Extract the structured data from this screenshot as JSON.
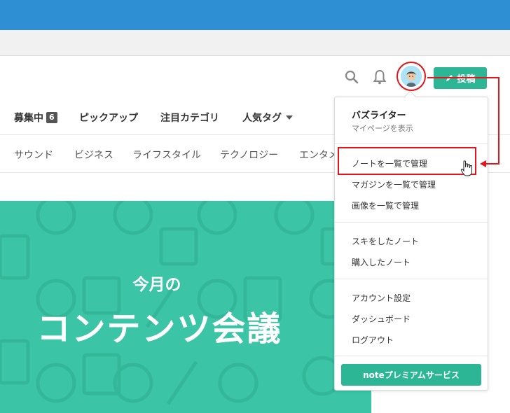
{
  "header": {
    "post_label": "投稿"
  },
  "nav_primary": [
    {
      "label": "募集中",
      "badge": "6"
    },
    {
      "label": "ピックアップ"
    },
    {
      "label": "注目カテゴリ"
    },
    {
      "label": "人気タグ"
    }
  ],
  "nav_secondary": [
    "サウンド",
    "ビジネス",
    "ライフスタイル",
    "テクノロジー",
    "エンタメ"
  ],
  "hero": {
    "subtitle": "今月の",
    "title": "コンテンツ会議"
  },
  "menu": {
    "user_name": "バズライター",
    "mypage": "マイページを表示",
    "items_manage": [
      "ノートを一覧で管理",
      "マガジンを一覧で管理",
      "画像を一覧で管理"
    ],
    "items_notes": [
      "スキをしたノート",
      "購入したノート"
    ],
    "items_account": [
      "アカウント設定",
      "ダッシュボード",
      "ログアウト"
    ],
    "premium_label": "noteプレミアムサービス"
  },
  "colors": {
    "brand": "#2cb696",
    "hero_bg": "#3bc4a6",
    "annotation": "#e3141b",
    "browser_top": "#2f8fd3"
  },
  "icons": [
    "search-icon",
    "bell-icon",
    "pen-icon",
    "caret-down-icon",
    "hand-cursor-icon"
  ]
}
